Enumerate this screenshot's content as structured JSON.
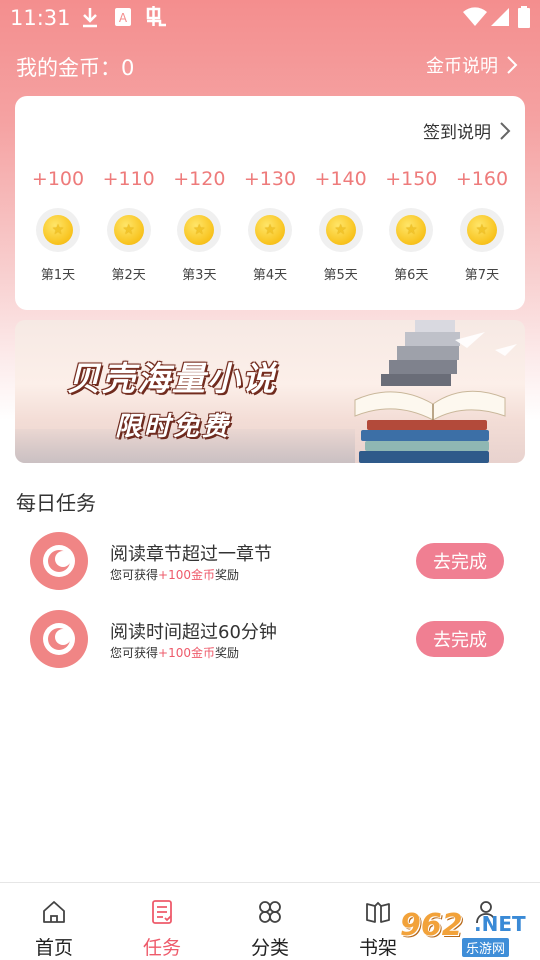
{
  "status_bar": {
    "time": "11:31",
    "icons": [
      "download-icon",
      "app-a-icon",
      "bug-icon",
      "wifi-icon",
      "signal-icon",
      "battery-icon"
    ]
  },
  "header": {
    "coins_label": "我的金币：0",
    "coins_explain": "金币说明"
  },
  "signin": {
    "explain": "签到说明",
    "days": [
      {
        "points": "+100",
        "label": "第1天"
      },
      {
        "points": "+110",
        "label": "第2天"
      },
      {
        "points": "+120",
        "label": "第3天"
      },
      {
        "points": "+130",
        "label": "第4天"
      },
      {
        "points": "+140",
        "label": "第5天"
      },
      {
        "points": "+150",
        "label": "第6天"
      },
      {
        "points": "+160",
        "label": "第7天"
      }
    ]
  },
  "banner": {
    "title": "贝壳海量小说",
    "subtitle": "限时免费"
  },
  "daily_tasks": {
    "title": "每日任务",
    "tasks": [
      {
        "title": "阅读章节超过一章节",
        "reward_prefix": "您可获得",
        "reward_value": "+100金币",
        "reward_suffix": "奖励",
        "button": "去完成"
      },
      {
        "title": "阅读时间超过60分钟",
        "reward_prefix": "您可获得",
        "reward_value": "+100金币",
        "reward_suffix": "奖励",
        "button": "去完成"
      }
    ]
  },
  "tabbar": {
    "tabs": [
      {
        "label": "首页",
        "icon": "home-icon"
      },
      {
        "label": "任务",
        "icon": "task-list-icon",
        "active": true
      },
      {
        "label": "分类",
        "icon": "category-icon"
      },
      {
        "label": "书架",
        "icon": "bookshelf-icon"
      },
      {
        "label": "我的",
        "icon": "profile-icon"
      }
    ]
  },
  "watermark": {
    "big": "962",
    "net": ".NET",
    "small": "乐游网"
  },
  "colors": {
    "accent": "#ee5b6b",
    "header_gradient_top": "#f48e8e",
    "button": "#f07f92",
    "task_icon": "#f08585"
  }
}
